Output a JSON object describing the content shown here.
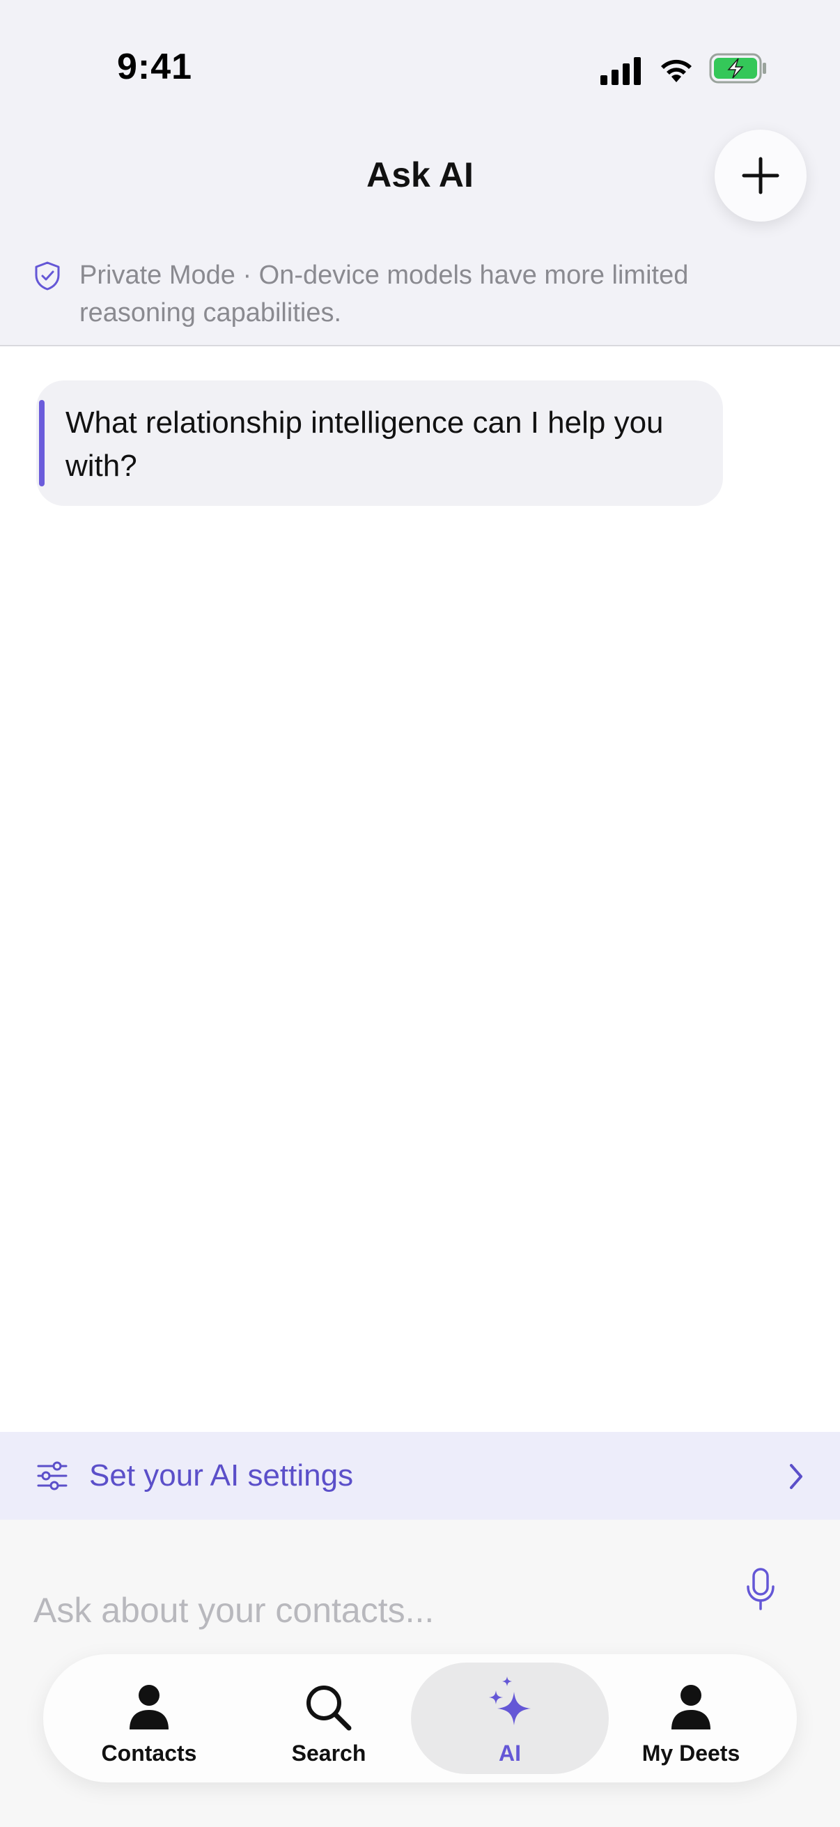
{
  "status": {
    "time": "9:41"
  },
  "header": {
    "title": "Ask AI",
    "new_chat_icon": "plus-icon"
  },
  "banner": {
    "icon": "shield-check-icon",
    "text": "Private Mode · On-device models have more limited reasoning capabilities."
  },
  "chat": {
    "assistant_message": "What relationship intelligence can I help you with?"
  },
  "settings_row": {
    "icon": "sliders-icon",
    "label": "Set your AI settings",
    "chevron": "chevron-right-icon"
  },
  "composer": {
    "placeholder": "Ask about your contacts...",
    "value": "",
    "mic_icon": "microphone-icon"
  },
  "tabbar": {
    "active": "AI",
    "tabs": [
      {
        "label": "Contacts",
        "icon": "person-icon"
      },
      {
        "label": "Search",
        "icon": "magnifier-icon"
      },
      {
        "label": "AI",
        "icon": "sparkles-icon"
      },
      {
        "label": "My Deets",
        "icon": "person-icon"
      }
    ]
  },
  "colors": {
    "accent": "#6457D6",
    "header_bg": "#F2F2F7",
    "settings_bg": "#EDEDFA",
    "battery": "#34C759"
  }
}
